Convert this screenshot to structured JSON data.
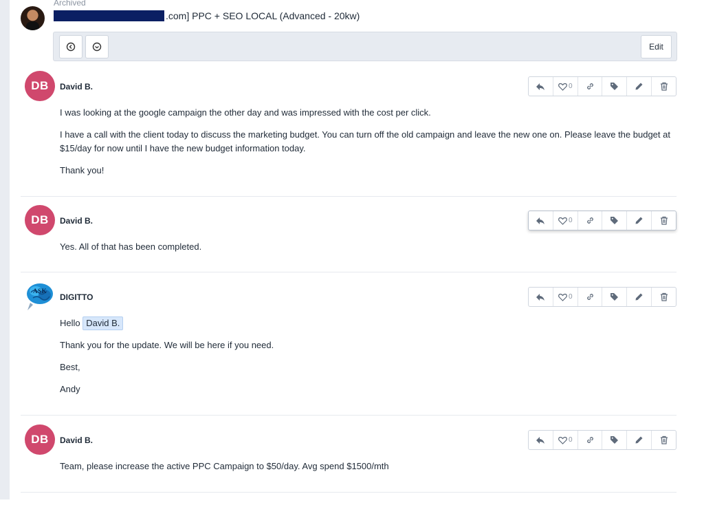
{
  "header": {
    "archived_label": "Archived",
    "title_suffix": ".com] PPC + SEO LOCAL (Advanced - 20kw)",
    "edit_label": "Edit"
  },
  "icons": {
    "back": "arrow-left-circle-icon",
    "forward": "minus-circle-icon",
    "reply": "reply-icon",
    "like": "heart-icon",
    "link": "link-icon",
    "tag": "tag-icon",
    "edit": "pencil-icon",
    "delete": "trash-icon"
  },
  "colors": {
    "avatar_bg": "#d0486d",
    "mention_bg": "#d7e7fb",
    "redaction": "#0b1f63"
  },
  "messages": [
    {
      "author": "David B.",
      "initials": "DB",
      "likes": "0",
      "paragraphs": [
        "I was looking at the google campaign the other day and was impressed with the cost per click.",
        "I have a call with the client today to discuss the marketing budget. You can turn off the old campaign and leave the new one on. Please leave the budget at $15/day for now until I have the new budget information today.",
        "Thank you!"
      ]
    },
    {
      "author": "David B.",
      "initials": "DB",
      "likes": "0",
      "paragraphs": [
        "Yes. All of that has been completed."
      ]
    },
    {
      "author": "DIGITTO",
      "logo_text": "ASK",
      "likes": "0",
      "greeting": "Hello",
      "mention": "David B.",
      "paragraphs": [
        "Thank you for the update. We will be here if you need.",
        "Best,",
        "Andy"
      ]
    },
    {
      "author": "David B.",
      "initials": "DB",
      "likes": "0",
      "paragraphs": [
        "Team, please increase the active PPC Campaign to $50/day. Avg spend $1500/mth"
      ]
    }
  ]
}
